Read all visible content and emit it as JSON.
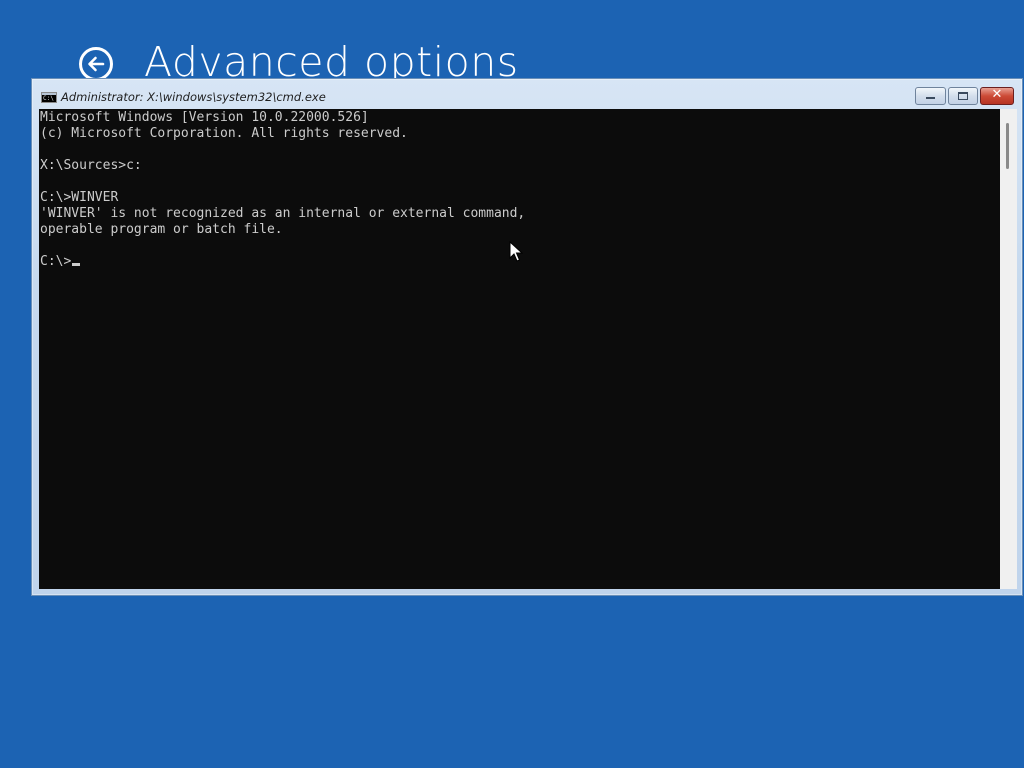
{
  "page": {
    "title": "Advanced options",
    "back_icon": "back-arrow-icon"
  },
  "window": {
    "title": "Administrator: X:\\windows\\system32\\cmd.exe",
    "icon": "cmd-icon",
    "controls": {
      "minimize_icon": "minimize-icon",
      "maximize_icon": "maximize-icon",
      "close_icon": "close-icon",
      "close_glyph": "✕"
    }
  },
  "console": {
    "lines": [
      "Microsoft Windows [Version 10.0.22000.526]",
      "(c) Microsoft Corporation. All rights reserved.",
      "",
      "X:\\Sources>c:",
      "",
      "C:\\>WINVER",
      "'WINVER' is not recognized as an internal or external command,",
      "operable program or batch file.",
      "",
      "C:\\>"
    ]
  },
  "colors": {
    "desktop_background": "#1c63b3",
    "console_background": "#0c0c0c",
    "console_text": "#cccccc",
    "close_button": "#c8412f"
  }
}
